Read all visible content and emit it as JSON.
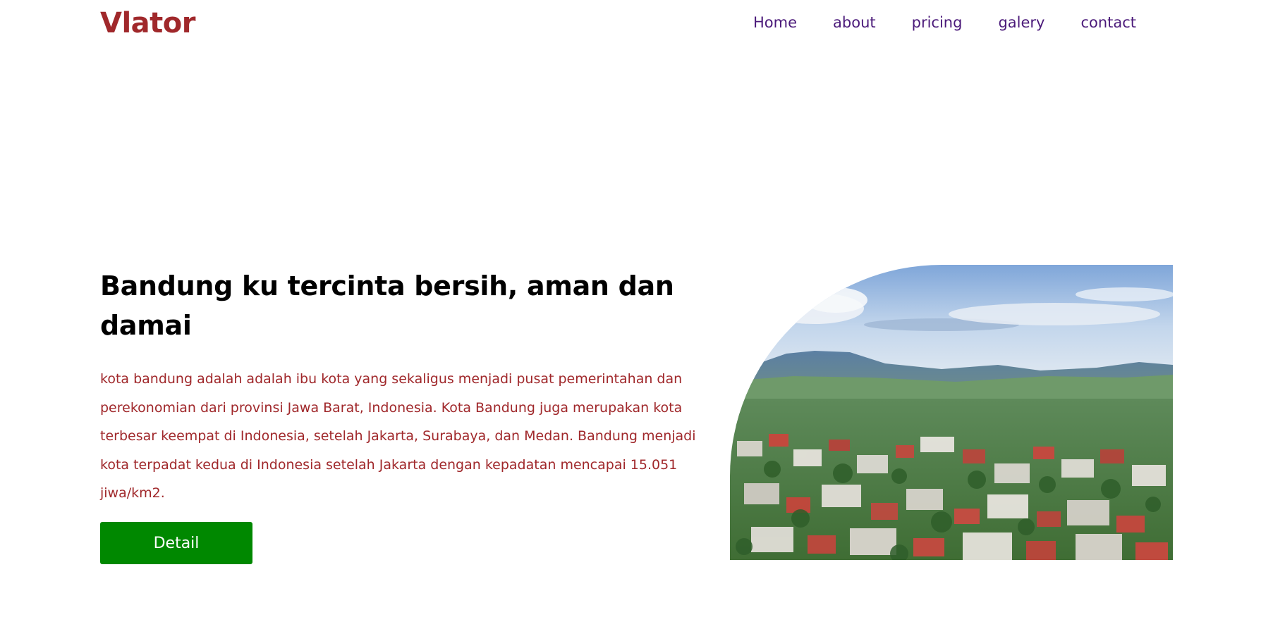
{
  "header": {
    "logo": "Vlator",
    "nav": [
      {
        "label": "Home"
      },
      {
        "label": "about"
      },
      {
        "label": "pricing"
      },
      {
        "label": "galery"
      },
      {
        "label": "contact"
      }
    ]
  },
  "hero": {
    "title": "Bandung ku tercinta bersih, aman dan damai",
    "description": "kota bandung adalah adalah ibu kota yang sekaligus menjadi pusat pemerintahan dan perekonomian dari provinsi Jawa Barat, Indonesia. Kota Bandung juga merupakan kota terbesar keempat di Indonesia, setelah Jakarta, Surabaya, dan Medan. Bandung menjadi kota terpadat kedua di Indonesia setelah Jakarta dengan kepadatan mencapai 15.051 jiwa/km2.",
    "button_label": "Detail",
    "image": "city-landscape-image"
  },
  "colors": {
    "logo": "#a0282b",
    "nav": "#4b1a7a",
    "description": "#a0282b",
    "button": "#008800"
  }
}
